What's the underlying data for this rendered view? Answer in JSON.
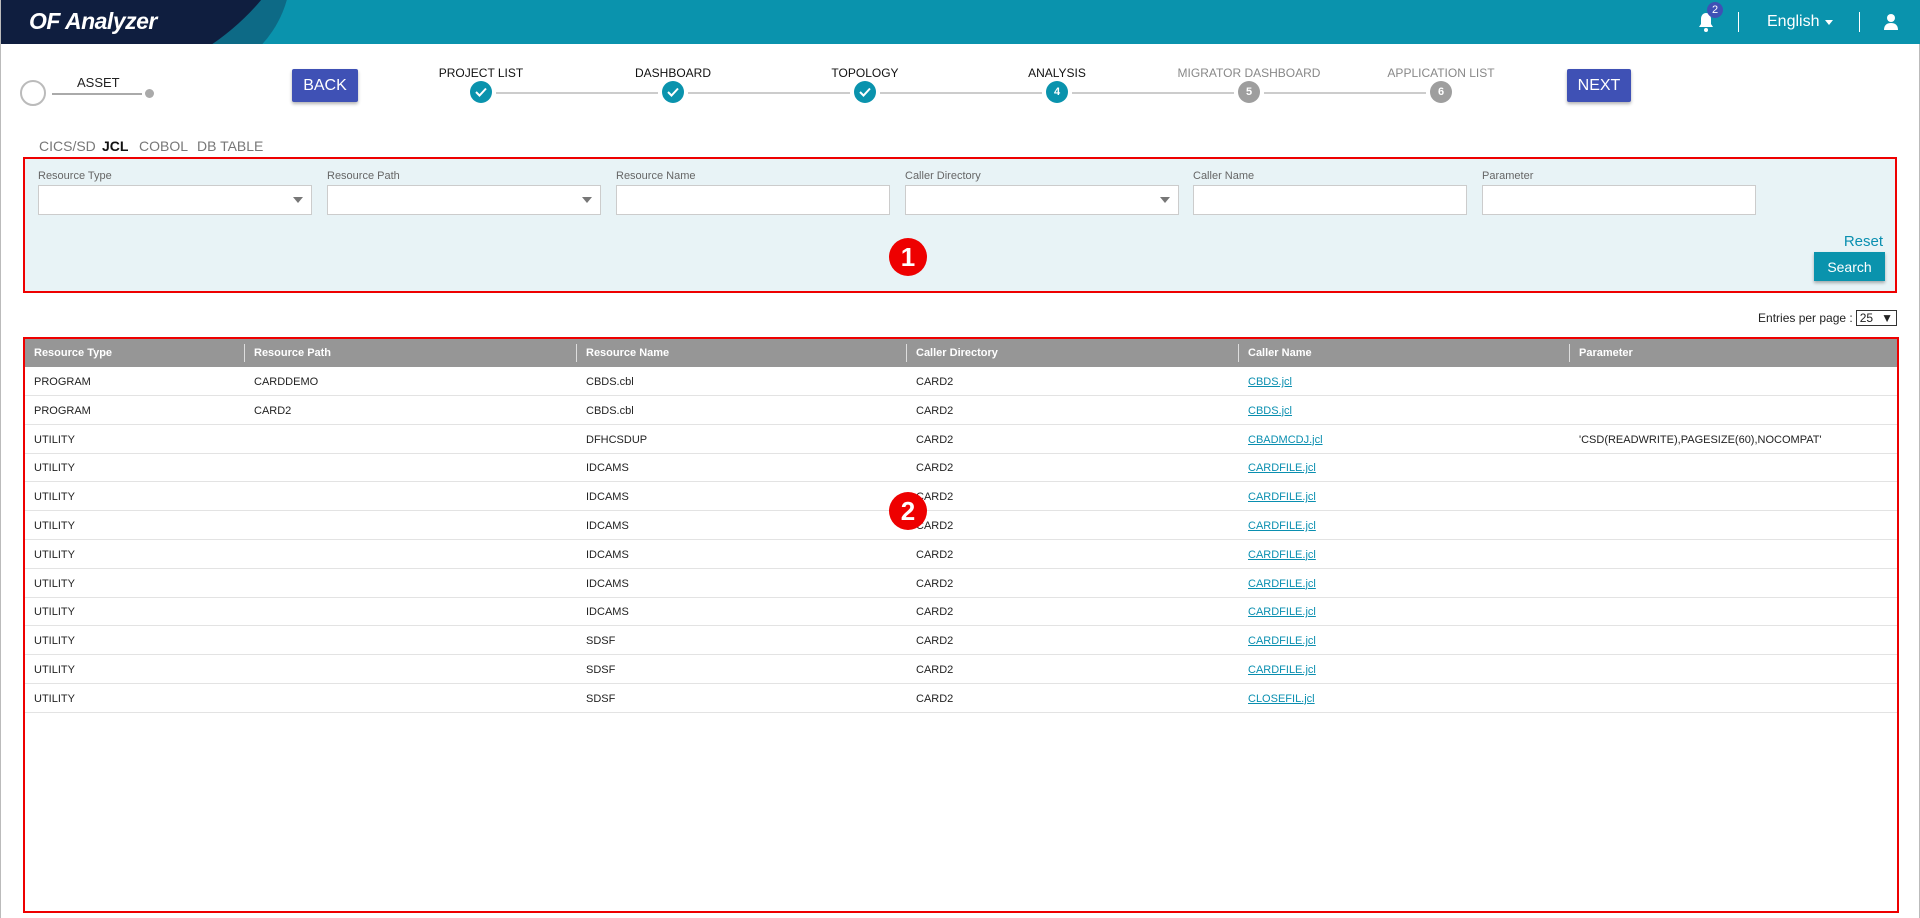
{
  "header": {
    "logo": "OF Analyzer",
    "notification_count": "2",
    "language": "English",
    "brand_color": "#0a93ad"
  },
  "asset": {
    "label": "ASSET"
  },
  "nav": {
    "back": "BACK",
    "next": "NEXT"
  },
  "steps": [
    {
      "label": "PROJECT LIST",
      "status": "done",
      "num": ""
    },
    {
      "label": "DASHBOARD",
      "status": "done",
      "num": ""
    },
    {
      "label": "TOPOLOGY",
      "status": "done",
      "num": ""
    },
    {
      "label": "ANALYSIS",
      "status": "active",
      "num": "4"
    },
    {
      "label": "MIGRATOR DASHBOARD",
      "status": "pending",
      "num": "5"
    },
    {
      "label": "APPLICATION LIST",
      "status": "pending",
      "num": "6"
    }
  ],
  "tabs": [
    {
      "label": "CICS/SD",
      "active": false
    },
    {
      "label": "JCL",
      "active": true
    },
    {
      "label": "COBOL",
      "active": false
    },
    {
      "label": "DB TABLE",
      "active": false
    }
  ],
  "filters": [
    {
      "label": "Resource Type",
      "type": "select",
      "value": ""
    },
    {
      "label": "Resource Path",
      "type": "select",
      "value": ""
    },
    {
      "label": "Resource Name",
      "type": "text",
      "value": ""
    },
    {
      "label": "Caller Directory",
      "type": "select",
      "value": ""
    },
    {
      "label": "Caller Name",
      "type": "text",
      "value": ""
    },
    {
      "label": "Parameter",
      "type": "text",
      "value": ""
    }
  ],
  "actions": {
    "reset": "Reset",
    "search": "Search"
  },
  "entries": {
    "label": "Entries per page :",
    "value": "25"
  },
  "markers": {
    "one": "1",
    "two": "2"
  },
  "table": {
    "columns": [
      "Resource Type",
      "Resource Path",
      "Resource Name",
      "Caller Directory",
      "Caller Name",
      "Parameter"
    ],
    "rows": [
      [
        "PROGRAM",
        "CARDDEMO",
        "CBDS.cbl",
        "CARD2",
        "CBDS.jcl",
        ""
      ],
      [
        "PROGRAM",
        "CARD2",
        "CBDS.cbl",
        "CARD2",
        "CBDS.jcl",
        ""
      ],
      [
        "UTILITY",
        "",
        "DFHCSDUP",
        "CARD2",
        "CBADMCDJ.jcl",
        "'CSD(READWRITE),PAGESIZE(60),NOCOMPAT'"
      ],
      [
        "UTILITY",
        "",
        "IDCAMS",
        "CARD2",
        "CARDFILE.jcl",
        ""
      ],
      [
        "UTILITY",
        "",
        "IDCAMS",
        "CARD2",
        "CARDFILE.jcl",
        ""
      ],
      [
        "UTILITY",
        "",
        "IDCAMS",
        "CARD2",
        "CARDFILE.jcl",
        ""
      ],
      [
        "UTILITY",
        "",
        "IDCAMS",
        "CARD2",
        "CARDFILE.jcl",
        ""
      ],
      [
        "UTILITY",
        "",
        "IDCAMS",
        "CARD2",
        "CARDFILE.jcl",
        ""
      ],
      [
        "UTILITY",
        "",
        "IDCAMS",
        "CARD2",
        "CARDFILE.jcl",
        ""
      ],
      [
        "UTILITY",
        "",
        "SDSF",
        "CARD2",
        "CARDFILE.jcl",
        ""
      ],
      [
        "UTILITY",
        "",
        "SDSF",
        "CARD2",
        "CARDFILE.jcl",
        ""
      ],
      [
        "UTILITY",
        "",
        "SDSF",
        "CARD2",
        "CLOSEFIL.jcl",
        ""
      ]
    ]
  }
}
